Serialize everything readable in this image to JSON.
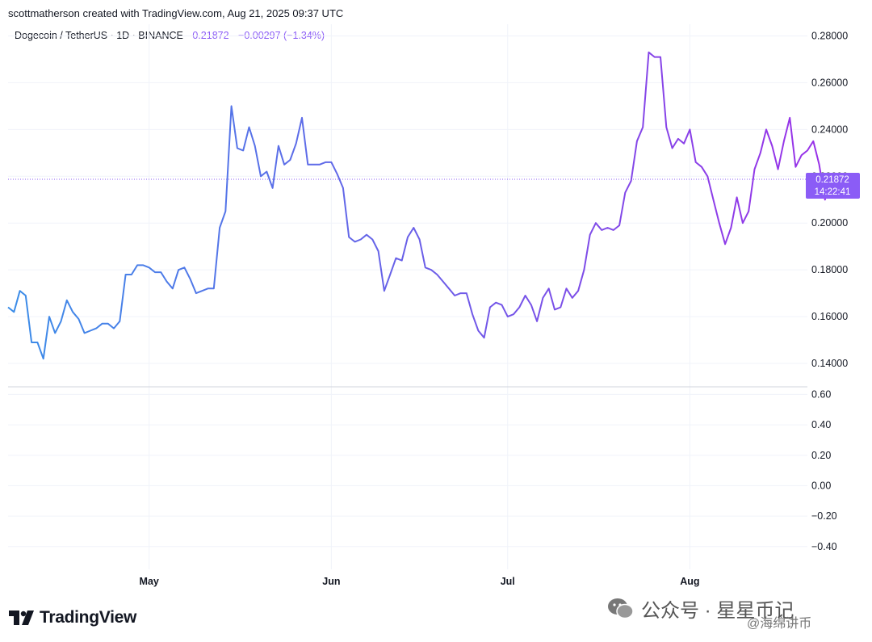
{
  "header": {
    "credit": "scottmatherson created with TradingView.com, Aug 21, 2025 09:37 UTC"
  },
  "legend": {
    "symbol": "Dogecoin / TetherUS · 1D · BINANCE",
    "price": "0.21872",
    "change": "−0.00297 (−1.34%)"
  },
  "price_badge": {
    "price": "0.21872",
    "countdown": "14:22:41"
  },
  "brand": {
    "name": "TradingView",
    "logo_icon": "tradingview-logo-icon"
  },
  "watermark": {
    "line1": "公众号 · 星星币记",
    "line2": "@海绵讲币",
    "icon": "wechat-icon"
  },
  "colors": {
    "line_start": "#3b8de8",
    "line_end": "#9b30e8",
    "accent": "#8b5cf6",
    "grid": "#f0f3fa"
  },
  "chart_data": [
    {
      "type": "line",
      "title": "Dogecoin / TetherUS · 1D · BINANCE",
      "x_start": "2025-04-07",
      "x_end": "2025-08-21",
      "ylim": [
        0.13,
        0.285
      ],
      "y_ticks": [
        "0.14000",
        "0.16000",
        "0.18000",
        "0.20000",
        "0.22000",
        "0.24000",
        "0.26000",
        "0.28000"
      ],
      "x_ticks": [
        {
          "date": "2025-05-01",
          "label": "May"
        },
        {
          "date": "2025-06-01",
          "label": "Jun"
        },
        {
          "date": "2025-07-01",
          "label": "Jul"
        },
        {
          "date": "2025-08-01",
          "label": "Aug"
        }
      ],
      "series": [
        {
          "values": [
            [
              "2025-04-07",
              0.164
            ],
            [
              "2025-04-08",
              0.162
            ],
            [
              "2025-04-09",
              0.171
            ],
            [
              "2025-04-10",
              0.169
            ],
            [
              "2025-04-11",
              0.149
            ],
            [
              "2025-04-12",
              0.149
            ],
            [
              "2025-04-13",
              0.142
            ],
            [
              "2025-04-14",
              0.16
            ],
            [
              "2025-04-15",
              0.153
            ],
            [
              "2025-04-16",
              0.158
            ],
            [
              "2025-04-17",
              0.167
            ],
            [
              "2025-04-18",
              0.162
            ],
            [
              "2025-04-19",
              0.159
            ],
            [
              "2025-04-20",
              0.153
            ],
            [
              "2025-04-21",
              0.154
            ],
            [
              "2025-04-22",
              0.155
            ],
            [
              "2025-04-23",
              0.157
            ],
            [
              "2025-04-24",
              0.157
            ],
            [
              "2025-04-25",
              0.155
            ],
            [
              "2025-04-26",
              0.158
            ],
            [
              "2025-04-27",
              0.178
            ],
            [
              "2025-04-28",
              0.178
            ],
            [
              "2025-04-29",
              0.182
            ],
            [
              "2025-04-30",
              0.182
            ],
            [
              "2025-05-01",
              0.181
            ],
            [
              "2025-05-02",
              0.179
            ],
            [
              "2025-05-03",
              0.179
            ],
            [
              "2025-05-04",
              0.175
            ],
            [
              "2025-05-05",
              0.172
            ],
            [
              "2025-05-06",
              0.18
            ],
            [
              "2025-05-07",
              0.181
            ],
            [
              "2025-05-08",
              0.176
            ],
            [
              "2025-05-09",
              0.17
            ],
            [
              "2025-05-10",
              0.171
            ],
            [
              "2025-05-11",
              0.172
            ],
            [
              "2025-05-12",
              0.172
            ],
            [
              "2025-05-13",
              0.198
            ],
            [
              "2025-05-14",
              0.205
            ],
            [
              "2025-05-15",
              0.25
            ],
            [
              "2025-05-16",
              0.232
            ],
            [
              "2025-05-17",
              0.231
            ],
            [
              "2025-05-18",
              0.241
            ],
            [
              "2025-05-19",
              0.233
            ],
            [
              "2025-05-20",
              0.22
            ],
            [
              "2025-05-21",
              0.222
            ],
            [
              "2025-05-22",
              0.215
            ],
            [
              "2025-05-23",
              0.233
            ],
            [
              "2025-05-24",
              0.225
            ],
            [
              "2025-05-25",
              0.227
            ],
            [
              "2025-05-26",
              0.234
            ],
            [
              "2025-05-27",
              0.245
            ],
            [
              "2025-05-28",
              0.225
            ],
            [
              "2025-05-29",
              0.225
            ],
            [
              "2025-05-30",
              0.225
            ],
            [
              "2025-05-31",
              0.226
            ],
            [
              "2025-06-01",
              0.226
            ],
            [
              "2025-06-02",
              0.221
            ],
            [
              "2025-06-03",
              0.215
            ],
            [
              "2025-06-04",
              0.194
            ],
            [
              "2025-06-05",
              0.192
            ],
            [
              "2025-06-06",
              0.193
            ],
            [
              "2025-06-07",
              0.195
            ],
            [
              "2025-06-08",
              0.193
            ],
            [
              "2025-06-09",
              0.188
            ],
            [
              "2025-06-10",
              0.171
            ],
            [
              "2025-06-11",
              0.178
            ],
            [
              "2025-06-12",
              0.185
            ],
            [
              "2025-06-13",
              0.184
            ],
            [
              "2025-06-14",
              0.194
            ],
            [
              "2025-06-15",
              0.198
            ],
            [
              "2025-06-16",
              0.193
            ],
            [
              "2025-06-17",
              0.181
            ],
            [
              "2025-06-18",
              0.18
            ],
            [
              "2025-06-19",
              0.178
            ],
            [
              "2025-06-20",
              0.175
            ],
            [
              "2025-06-21",
              0.172
            ],
            [
              "2025-06-22",
              0.169
            ],
            [
              "2025-06-23",
              0.17
            ],
            [
              "2025-06-24",
              0.17
            ],
            [
              "2025-06-25",
              0.161
            ],
            [
              "2025-06-26",
              0.154
            ],
            [
              "2025-06-27",
              0.151
            ],
            [
              "2025-06-28",
              0.164
            ],
            [
              "2025-06-29",
              0.166
            ],
            [
              "2025-06-30",
              0.165
            ],
            [
              "2025-07-01",
              0.16
            ],
            [
              "2025-07-02",
              0.161
            ],
            [
              "2025-07-03",
              0.164
            ],
            [
              "2025-07-04",
              0.169
            ],
            [
              "2025-07-05",
              0.165
            ],
            [
              "2025-07-06",
              0.158
            ],
            [
              "2025-07-07",
              0.168
            ],
            [
              "2025-07-08",
              0.172
            ],
            [
              "2025-07-09",
              0.163
            ],
            [
              "2025-07-10",
              0.164
            ],
            [
              "2025-07-11",
              0.172
            ],
            [
              "2025-07-12",
              0.168
            ],
            [
              "2025-07-13",
              0.171
            ],
            [
              "2025-07-14",
              0.18
            ],
            [
              "2025-07-15",
              0.195
            ],
            [
              "2025-07-16",
              0.2
            ],
            [
              "2025-07-17",
              0.197
            ],
            [
              "2025-07-18",
              0.198
            ],
            [
              "2025-07-19",
              0.197
            ],
            [
              "2025-07-20",
              0.199
            ],
            [
              "2025-07-21",
              0.213
            ],
            [
              "2025-07-22",
              0.218
            ],
            [
              "2025-07-23",
              0.235
            ],
            [
              "2025-07-24",
              0.241
            ],
            [
              "2025-07-25",
              0.273
            ],
            [
              "2025-07-26",
              0.271
            ],
            [
              "2025-07-27",
              0.271
            ],
            [
              "2025-07-28",
              0.241
            ],
            [
              "2025-07-29",
              0.232
            ],
            [
              "2025-07-30",
              0.236
            ],
            [
              "2025-07-31",
              0.234
            ],
            [
              "2025-08-01",
              0.24
            ],
            [
              "2025-08-02",
              0.226
            ],
            [
              "2025-08-03",
              0.224
            ],
            [
              "2025-08-04",
              0.22
            ],
            [
              "2025-08-05",
              0.21
            ],
            [
              "2025-08-06",
              0.2
            ],
            [
              "2025-08-07",
              0.191
            ],
            [
              "2025-08-08",
              0.198
            ],
            [
              "2025-08-09",
              0.211
            ],
            [
              "2025-08-10",
              0.2
            ],
            [
              "2025-08-11",
              0.205
            ],
            [
              "2025-08-12",
              0.223
            ],
            [
              "2025-08-13",
              0.23
            ],
            [
              "2025-08-14",
              0.24
            ],
            [
              "2025-08-15",
              0.233
            ],
            [
              "2025-08-16",
              0.223
            ],
            [
              "2025-08-17",
              0.235
            ],
            [
              "2025-08-18",
              0.245
            ],
            [
              "2025-08-19",
              0.224
            ],
            [
              "2025-08-20",
              0.229
            ],
            [
              "2025-08-21",
              0.231
            ],
            [
              "2025-08-22",
              0.235
            ],
            [
              "2025-08-23",
              0.225
            ],
            [
              "2025-08-24",
              0.21
            ],
            [
              "2025-08-25",
              0.221
            ],
            [
              "2025-08-26",
              0.219
            ]
          ]
        }
      ]
    },
    {
      "type": "line",
      "title": "",
      "ylim": [
        -0.55,
        0.65
      ],
      "y_ticks": [
        "0.60",
        "0.40",
        "0.20",
        "0.00",
        "−0.20",
        "−0.40"
      ],
      "series": []
    }
  ]
}
